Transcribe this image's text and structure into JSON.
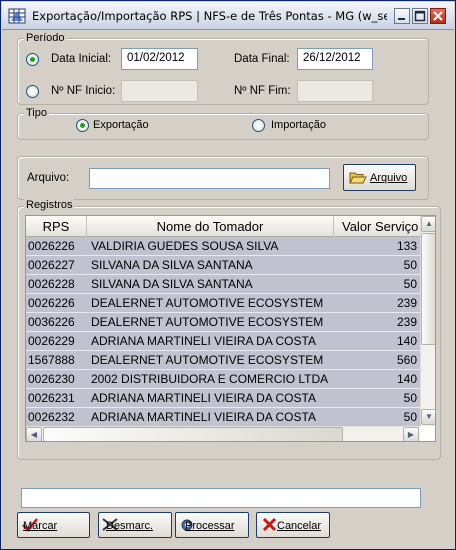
{
  "window": {
    "title": "Exportação/Importação RPS  |  NFS-e de Três Pontas - MG (w_sef_...",
    "icon": "app-grid-icon",
    "controls": [
      "minimize-icon",
      "maximize-icon",
      "close-icon"
    ]
  },
  "periodo": {
    "label": "Período",
    "data_inicial_label": "Data Inicial:",
    "data_inicial_value": "01/02/2012",
    "data_final_label": "Data Final:",
    "data_final_value": "26/12/2012",
    "nf_inicio_label": "Nº NF Inicio:",
    "nf_inicio_value": "",
    "nf_fim_label": "Nº NF Fim:",
    "nf_fim_value": "",
    "data_selected": true,
    "nf_selected": false
  },
  "tipo": {
    "label": "Tipo",
    "exportacao_label": "Exportação",
    "importacao_label": "Importação",
    "selected": "Exportação"
  },
  "arquivo": {
    "label": "Arquivo:",
    "value": "",
    "button_label": "Arquivo"
  },
  "registros": {
    "label": "Registros",
    "columns": [
      "RPS",
      "Nome do Tomador",
      "Valor Serviço"
    ],
    "rows": [
      {
        "rps": "0026226",
        "nome": "VALDIRIA GUEDES SOUSA SILVA",
        "valor": "133"
      },
      {
        "rps": "0026227",
        "nome": " SILVANA DA SILVA SANTANA",
        "valor": "50"
      },
      {
        "rps": "0026228",
        "nome": " SILVANA DA SILVA SANTANA",
        "valor": "50"
      },
      {
        "rps": "0026226",
        "nome": "DEALERNET AUTOMOTIVE ECOSYSTEM",
        "valor": "239"
      },
      {
        "rps": "0036226",
        "nome": "DEALERNET AUTOMOTIVE ECOSYSTEM",
        "valor": "239"
      },
      {
        "rps": "0026229",
        "nome": "ADRIANA MARTINELI VIEIRA DA COSTA",
        "valor": "140"
      },
      {
        "rps": "1567888",
        "nome": "DEALERNET AUTOMOTIVE ECOSYSTEM",
        "valor": "560"
      },
      {
        "rps": "0026230",
        "nome": "2002 DISTRIBUIDORA E COMERCIO LTDA",
        "valor": "140"
      },
      {
        "rps": "0026231",
        "nome": "ADRIANA MARTINELI VIEIRA DA COSTA",
        "valor": "50"
      },
      {
        "rps": "0026232",
        "nome": "ADRIANA MARTINELI VIEIRA DA COSTA",
        "valor": "50"
      }
    ]
  },
  "status_value": "",
  "buttons": {
    "marcar": "Marcar",
    "desmarcar": "Desmarc.",
    "processar": "Processar",
    "cancelar": "Cancelar"
  },
  "colors": {
    "window_bg": "#d4d0c8",
    "row_selected": "#c0c2d0",
    "field_border": "#7f9db9",
    "button_border": "#1d3c6e"
  }
}
